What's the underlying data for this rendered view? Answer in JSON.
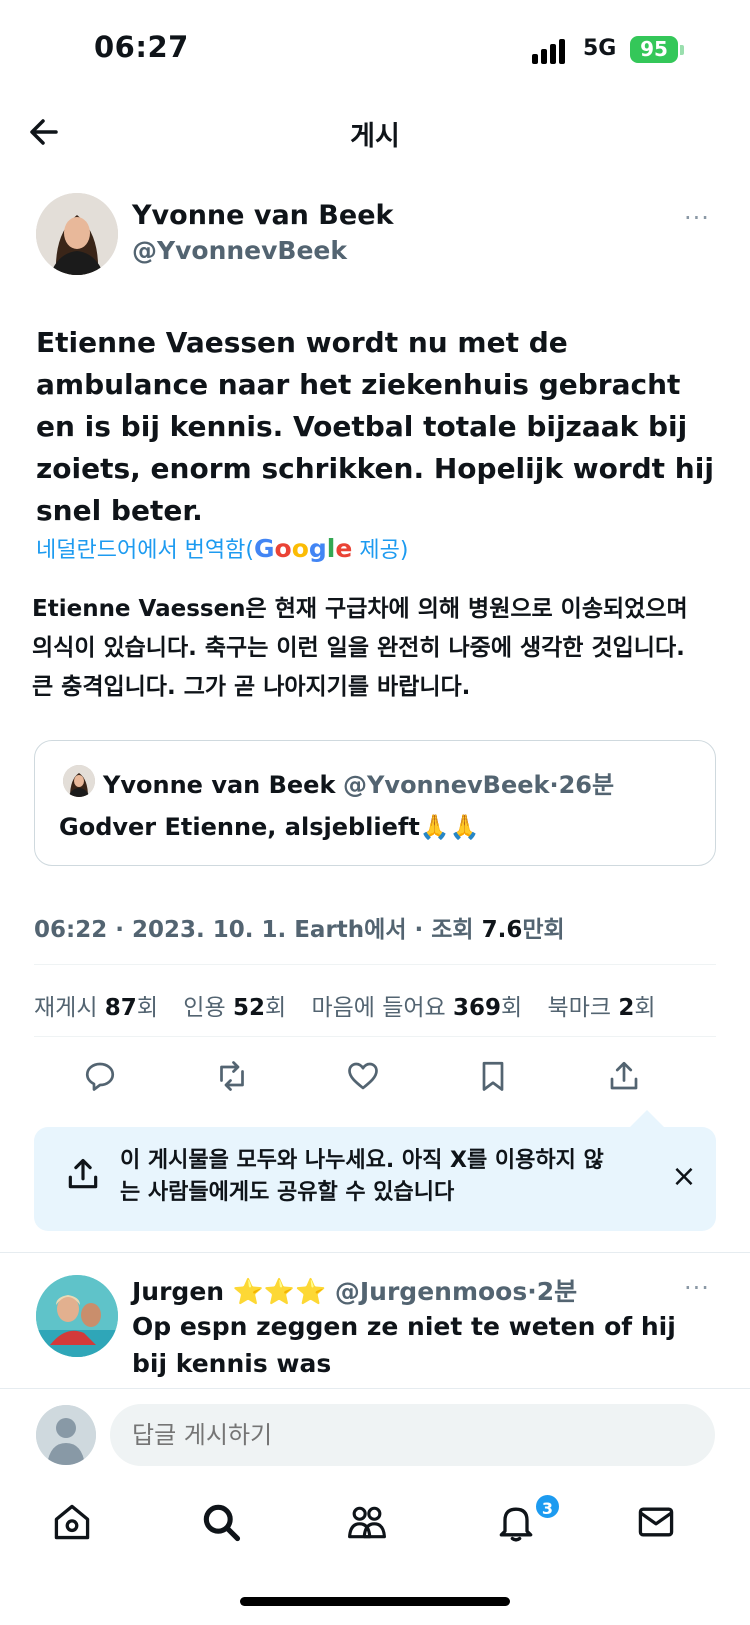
{
  "status_bar": {
    "time": "06:27",
    "network": "5G",
    "battery": "95"
  },
  "header": {
    "title": "게시"
  },
  "post": {
    "author_name": "Yvonne van Beek",
    "author_handle": "@YvonnevBeek",
    "more_label": "···",
    "text": "Etienne Vaessen wordt nu met de ambulance naar het ziekenhuis gebracht en is bij kennis. Voetbal totale bijzaak bij zoiets, enorm schrikken. Hopelijk wordt hij snel beter.",
    "translate_prefix": "네덜란드어에서 번역함(",
    "translate_google": [
      "G",
      "o",
      "o",
      "g",
      "l",
      "e"
    ],
    "translate_suffix": " 제공)",
    "translated_text": "Etienne Vaessen은 현재 구급차에 의해 병원으로 이송되었으며 의식이 있습니다. 축구는 이런 일을 완전히 나중에 생각한 것입니다. 큰 충격입니다. 그가 곧 나아지기를 바랍니다."
  },
  "quote": {
    "name": "Yvonne van Beek",
    "handle": "@YvonnevBeek",
    "time": "·26분",
    "text": "Godver Etienne, alsjeblieft🙏🙏"
  },
  "meta": {
    "time": "06:22 · 2023. 10. 1. Earth에서 · 조회 ",
    "views_value": "7.6",
    "views_unit": "만회"
  },
  "stats": [
    {
      "label": "재게시 ",
      "value": "87",
      "unit": "회"
    },
    {
      "label": "인용 ",
      "value": "52",
      "unit": "회"
    },
    {
      "label": "마음에 들어요 ",
      "value": "369",
      "unit": "회"
    },
    {
      "label": "북마크 ",
      "value": "2",
      "unit": "회"
    }
  ],
  "share_banner": {
    "text": "이 게시물을 모두와 나누세요. 아직 X를 이용하지 않는 사람들에게도 공유할 수 있습니다",
    "close": "×"
  },
  "reply": {
    "name": "Jurgen ",
    "stars": "⭐⭐⭐",
    "handle": " @Jurgenmoos·2분",
    "text": "Op espn zeggen ze niet te weten of hij bij kennis was",
    "more_label": "···"
  },
  "composer": {
    "placeholder": "답글 게시하기"
  },
  "tabbar": {
    "notification_count": "3"
  },
  "colors": {
    "accent": "#1d9bf0",
    "banner_bg": "#e8f5fd",
    "muted": "#536471",
    "battery": "#34c759"
  }
}
